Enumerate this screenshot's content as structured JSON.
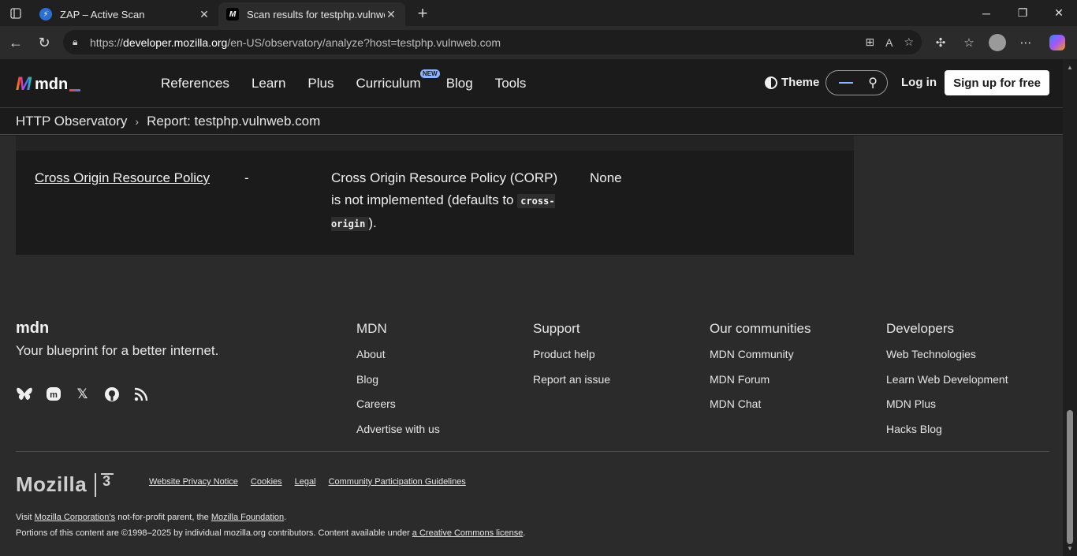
{
  "browser": {
    "tabs": [
      {
        "title": "ZAP – Active Scan",
        "active": false
      },
      {
        "title": "Scan results for testphp.vulnweb.c",
        "active": true
      }
    ],
    "url": {
      "prefix": "https://",
      "host": "developer.mozilla.org",
      "path": "/en-US/observatory/analyze?host=testphp.vulnweb.com"
    }
  },
  "mdn": {
    "logo_text": "mdn",
    "nav": [
      "References",
      "Learn",
      "Plus",
      "Curriculum",
      "Blog",
      "Tools"
    ],
    "new_badge": "NEW",
    "theme_label": "Theme",
    "login_label": "Log in",
    "signup_label": "Sign up for free"
  },
  "breadcrumb": {
    "root": "HTTP Observatory",
    "current": "Report: testphp.vulnweb.com"
  },
  "results_row": {
    "test": "Cross Origin Resource Policy",
    "score": "-",
    "reason_before": "Cross Origin Resource Policy (CORP) is not implemented (defaults to ",
    "reason_code": "cross-origin",
    "reason_after": ").",
    "recommendation": "None"
  },
  "footer": {
    "logo_text": "mdn",
    "tagline": "Your blueprint for a better internet.",
    "columns": [
      {
        "heading": "MDN",
        "links": [
          "About",
          "Blog",
          "Careers",
          "Advertise with us"
        ]
      },
      {
        "heading": "Support",
        "links": [
          "Product help",
          "Report an issue"
        ]
      },
      {
        "heading": "Our communities",
        "links": [
          "MDN Community",
          "MDN Forum",
          "MDN Chat"
        ]
      },
      {
        "heading": "Developers",
        "links": [
          "Web Technologies",
          "Learn Web Development",
          "MDN Plus",
          "Hacks Blog"
        ]
      }
    ],
    "mozilla_word": "Mozilla",
    "legal_links": [
      "Website Privacy Notice",
      "Cookies",
      "Legal",
      "Community Participation Guidelines"
    ],
    "visit_text_1": "Visit ",
    "visit_link_1": "Mozilla Corporation’s",
    "visit_text_2": " not-for-profit parent, the ",
    "visit_link_2": "Mozilla Foundation",
    "visit_text_3": ".",
    "portions_text": "Portions of this content are ©1998–2025 by individual mozilla.org contributors. Content available under ",
    "portions_link": "a Creative Commons license",
    "portions_end": "."
  }
}
